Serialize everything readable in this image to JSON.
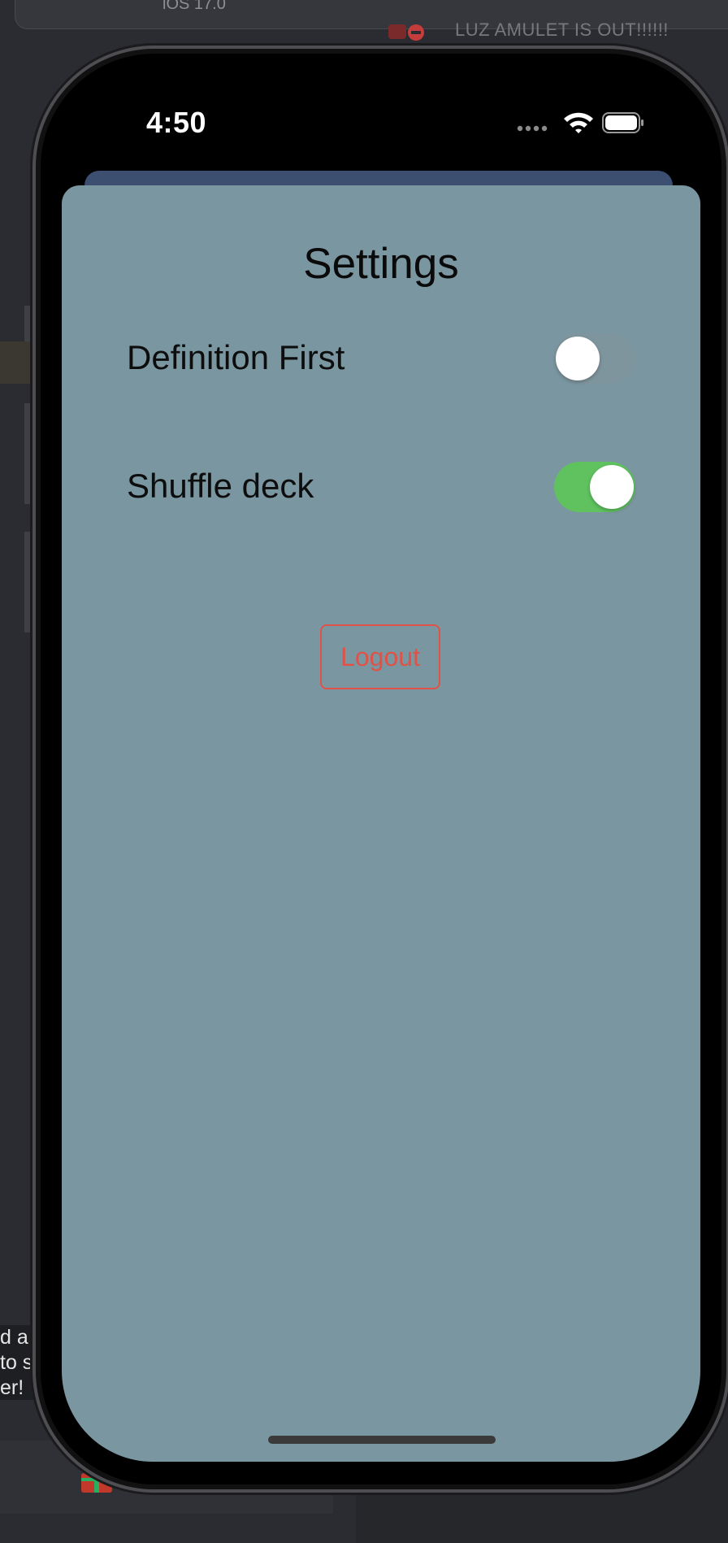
{
  "host": {
    "top_bar_text": "iOS 17.0",
    "banner_text": "LUZ AMULET IS OUT!!!!!!",
    "toast_lines": [
      "d a",
      "to s",
      "er!"
    ]
  },
  "status_bar": {
    "time": "4:50",
    "icons": [
      "cellular-dots-icon",
      "wifi-icon",
      "battery-icon"
    ]
  },
  "settings": {
    "title": "Settings",
    "rows": [
      {
        "label": "Definition First",
        "enabled": false
      },
      {
        "label": "Shuffle deck",
        "enabled": true
      }
    ],
    "logout_label": "Logout"
  },
  "colors": {
    "sheet_background": "#7a96a0",
    "toggle_on": "#5fc25f",
    "logout_accent": "#e05247",
    "sheet_behind": "#3c4f70"
  }
}
